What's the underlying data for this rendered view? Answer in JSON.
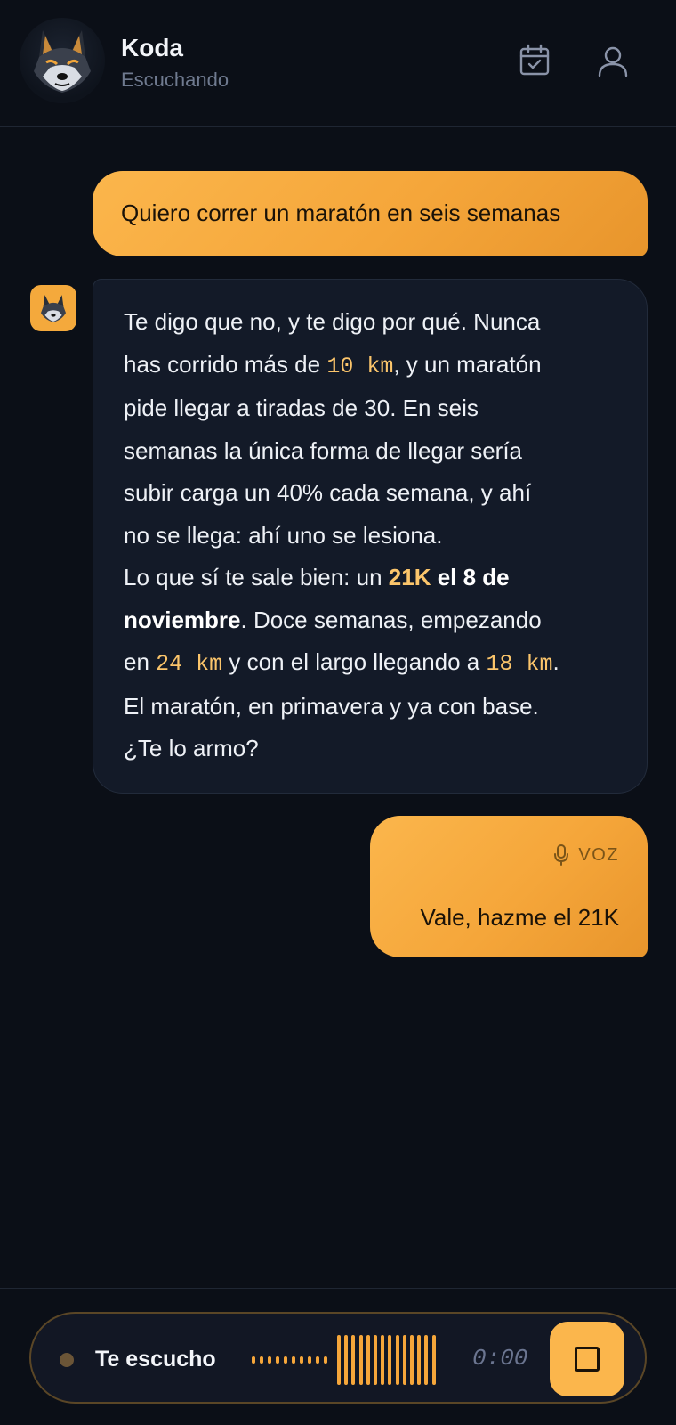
{
  "header": {
    "title": "Koda",
    "status": "Escuchando",
    "icons": [
      "wolf-avatar",
      "calendar-check-icon",
      "user-icon"
    ]
  },
  "messages": [
    {
      "role": "user",
      "text": "Quiero correr un maratón en seis semanas"
    },
    {
      "role": "assistant",
      "lines": {
        "l1": "Te digo que no, y te digo por qué. Nunca",
        "l2a": "has corrido más de ",
        "l2b": "10 km",
        "l2c": ", y un maratón",
        "l3": "pide llegar a tiradas de 30. En seis",
        "l4": "semanas la única forma de llegar sería",
        "l5": "subir carga un 40% cada semana, y ahí",
        "l6": "no se llega: ahí uno se lesiona.",
        "l7a": "Lo que sí te sale bien: un ",
        "l7b": "21K",
        "l7c": " el 8 de",
        "l8a": "noviembre",
        "l8b": ". Doce semanas, empezando",
        "l9a": "en ",
        "l9b": "24 km",
        "l9c": " y con el largo llegando a ",
        "l9d": "18 km",
        "l9e": ".",
        "l10": "El maratón, en primavera y ya con base.",
        "l11": "¿Te lo armo?"
      }
    },
    {
      "role": "user",
      "tag": "VOZ",
      "text": "Vale, hazme el 21K"
    }
  ],
  "recorder": {
    "label": "Te escucho",
    "timer": "0:00",
    "stop_icon": "stop-icon"
  },
  "colors": {
    "background": "#0b0f17",
    "accent": "#fbb64c",
    "bot_bubble": "#131a28",
    "mono_highlight": "#fbc56b"
  }
}
